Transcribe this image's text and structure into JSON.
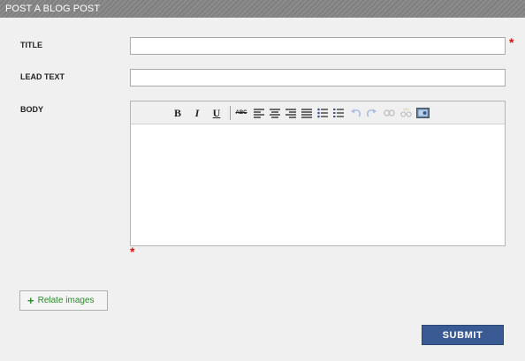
{
  "header": {
    "title": "POST A BLOG POST"
  },
  "form": {
    "title_label": "TITLE",
    "title_value": "",
    "lead_label": "LEAD TEXT",
    "lead_value": "",
    "body_label": "BODY",
    "required_marker": "*"
  },
  "toolbar": {
    "bold": "B",
    "italic": "I",
    "underline": "U",
    "strikethrough": "ABC"
  },
  "actions": {
    "relate_plus": "+",
    "relate_label": "Relate images",
    "submit_label": "SUBMIT"
  },
  "colors": {
    "header_bg": "#8c8c8c",
    "panel_bg": "#f0f0f0",
    "required": "#e01010",
    "submit_bg": "#3a5a94",
    "relate_text": "#2d8a2d"
  }
}
